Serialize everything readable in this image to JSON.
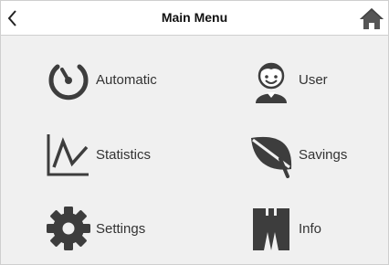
{
  "header": {
    "title": "Main Menu",
    "back_icon": "chevron-left-icon",
    "home_icon": "home-icon"
  },
  "menu": {
    "items": [
      {
        "label": "Automatic",
        "icon": "timer-icon"
      },
      {
        "label": "User",
        "icon": "user-icon"
      },
      {
        "label": "Statistics",
        "icon": "chart-icon"
      },
      {
        "label": "Savings",
        "icon": "leaf-icon"
      },
      {
        "label": "Settings",
        "icon": "gear-icon"
      },
      {
        "label": "Info",
        "icon": "info-columns-icon"
      }
    ]
  },
  "colors": {
    "icon": "#3d3d3d",
    "background": "#f0f0f0",
    "header_background": "#ffffff"
  }
}
